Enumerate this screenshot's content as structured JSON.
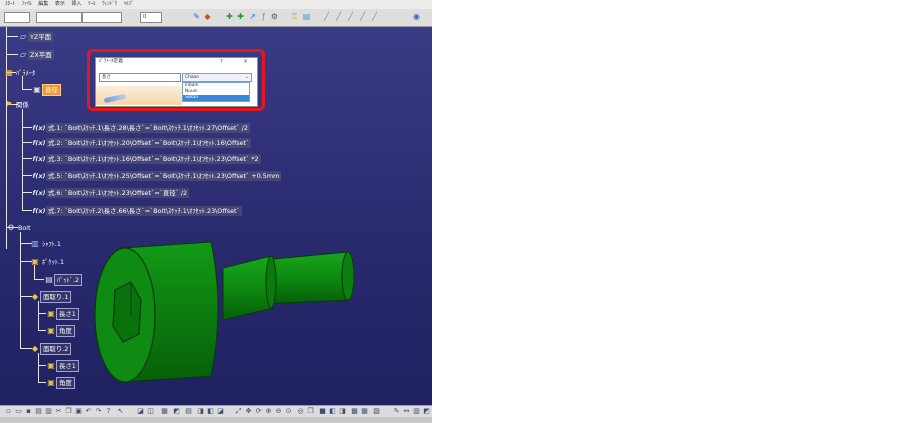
{
  "menu": [
    "ｽﾀｰﾄ",
    "ﾌｧｲﾙ",
    "編集",
    "表示",
    "挿入",
    "ﾂｰﾙ",
    "ｳｨﾝﾄﾞｳ",
    "ﾍﾙﾌﾟ"
  ],
  "toolbar": {
    "combo1": "",
    "combo2": "",
    "combo3": "0"
  },
  "tree": {
    "yz_plane": "YZ平面",
    "zx_plane": "ZX平面",
    "parameters": "ﾊﾟﾗﾒｰﾀ",
    "param_child": "直径",
    "relations": "関係",
    "formulas": [
      "式.1: `Bolt\\ｽｹｯﾁ.1\\長さ.28\\長さ`=`Bolt\\ｽｹｯﾁ.1\\ｵﾌｾｯﾄ.27\\Offset` /2",
      "式.2: `Bolt\\ｽｹｯﾁ.1\\ｵﾌｾｯﾄ.20\\Offset`=`Bolt\\ｽｹｯﾁ.1\\ｵﾌｾｯﾄ.16\\Offset`",
      "式.3: `Bolt\\ｽｹｯﾁ.1\\ｵﾌｾｯﾄ.16\\Offset`=`Bolt\\ｽｹｯﾁ.1\\ｵﾌｾｯﾄ.23\\Offset` *2",
      "式.5: `Bolt\\ｽｹｯﾁ.1\\ｵﾌｾｯﾄ.25\\Offset`=`Bolt\\ｽｹｯﾁ.1\\ｵﾌｾｯﾄ.23\\Offset` +0.5mm",
      "式.6: `Bolt\\ｽｹｯﾁ.1\\ｵﾌｾｯﾄ.23\\Offset`=`直径` /2",
      "式.7: `Bolt\\ｽｹｯﾁ.2\\長さ.66\\長さ`=`Bolt\\ｽｹｯﾁ.1\\ｵﾌｾｯﾄ.23\\Offset`"
    ],
    "body": "Bolt",
    "shaft": "ｼｬﾌﾄ.1",
    "pocket": "ﾎﾟｹｯﾄ.1",
    "pad": "ﾊﾟｯﾄﾞ.2",
    "chamfer": "面取り.1",
    "ch_child1": "長さ1",
    "ch_child2": "角度",
    "chamfer2": "面取り.2",
    "ch2_child1": "長さ1",
    "ch2_child2": "角度"
  },
  "dialog": {
    "title": "ﾊﾟﾗﾒｰﾀ定義",
    "help": "?",
    "close": "×",
    "input_value": "長さ",
    "select_value": "Chaan",
    "options": [
      "Inbam",
      "Nuuni",
      "Sokaa"
    ],
    "selected_index": 2
  },
  "colors": {
    "viewport": "#2e2f6e",
    "bolt_green": "#0f8a12",
    "highlight": "#e8161c",
    "orange_node": "#f3962a"
  },
  "status": ""
}
